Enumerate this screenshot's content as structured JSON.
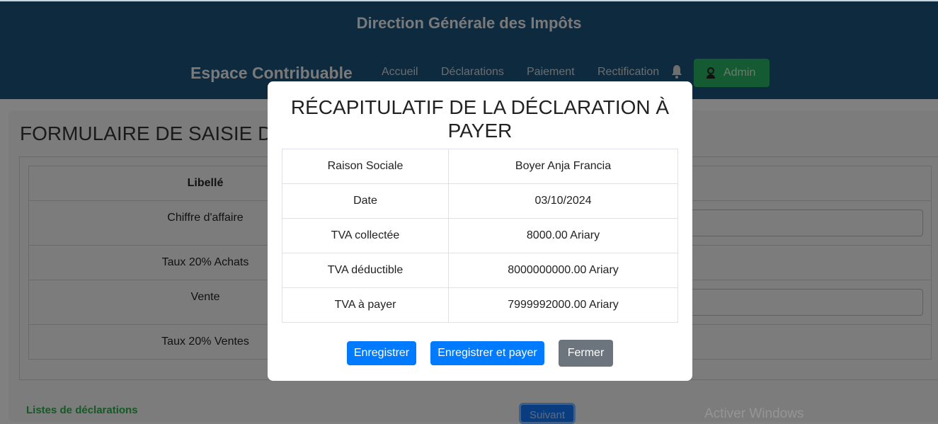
{
  "header": {
    "site_title": "Direction Générale des Impôts",
    "brand": "Espace Contribuable",
    "nav": [
      "Accueil",
      "Déclarations",
      "Paiement",
      "Rectification"
    ],
    "user_button": "Admin"
  },
  "form": {
    "title": "FORMULAIRE DE SAISIE DE",
    "column_header": "Libellé",
    "rows": [
      "Chiffre d'affaire",
      "Taux 20% Achats",
      "Vente",
      "Taux 20% Ventes"
    ],
    "list_title": "Listes de déclarations",
    "next_button": "Suivant"
  },
  "watermark": "Activer Windows",
  "modal": {
    "title": "RÉCAPITULATIF DE LA DÉCLARATION À PAYER",
    "rows": [
      {
        "label": "Raison Sociale",
        "value": "Boyer Anja Francia"
      },
      {
        "label": "Date",
        "value": "03/10/2024"
      },
      {
        "label": "TVA collectée",
        "value": "8000.00 Ariary"
      },
      {
        "label": "TVA déductible",
        "value": "8000000000.00 Ariary"
      },
      {
        "label": "TVA à payer",
        "value": "7999992000.00 Ariary"
      }
    ],
    "buttons": {
      "save": "Enregistrer",
      "save_pay": "Enregistrer et payer",
      "close": "Fermer"
    }
  },
  "colors": {
    "primary": "#007bff",
    "secondary": "#6c757d",
    "success": "#28a745",
    "header": "#1b4a7a"
  }
}
